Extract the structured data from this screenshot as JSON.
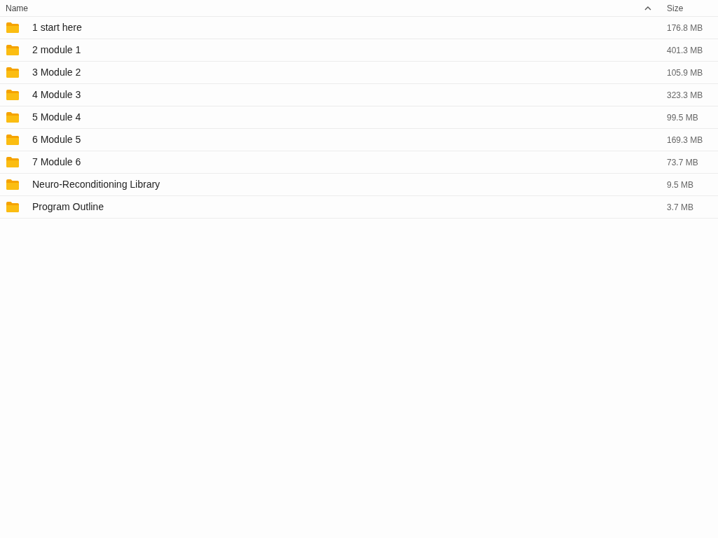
{
  "columns": [
    {
      "label": "Name",
      "sorted": true
    },
    {
      "label": "Size",
      "sorted": false
    }
  ],
  "rows": [
    {
      "name": "1 start here",
      "size": "176.8 MB"
    },
    {
      "name": "2 module 1",
      "size": "401.3 MB"
    },
    {
      "name": "3 Module 2",
      "size": "105.9 MB"
    },
    {
      "name": "4 Module 3",
      "size": "323.3 MB"
    },
    {
      "name": "5 Module 4",
      "size": "99.5 MB"
    },
    {
      "name": "6 Module 5",
      "size": "169.3 MB"
    },
    {
      "name": "7 Module 6",
      "size": "73.7 MB"
    },
    {
      "name": "Neuro-Reconditioning Library",
      "size": "9.5 MB"
    },
    {
      "name": "Program Outline",
      "size": "3.7 MB"
    }
  ]
}
